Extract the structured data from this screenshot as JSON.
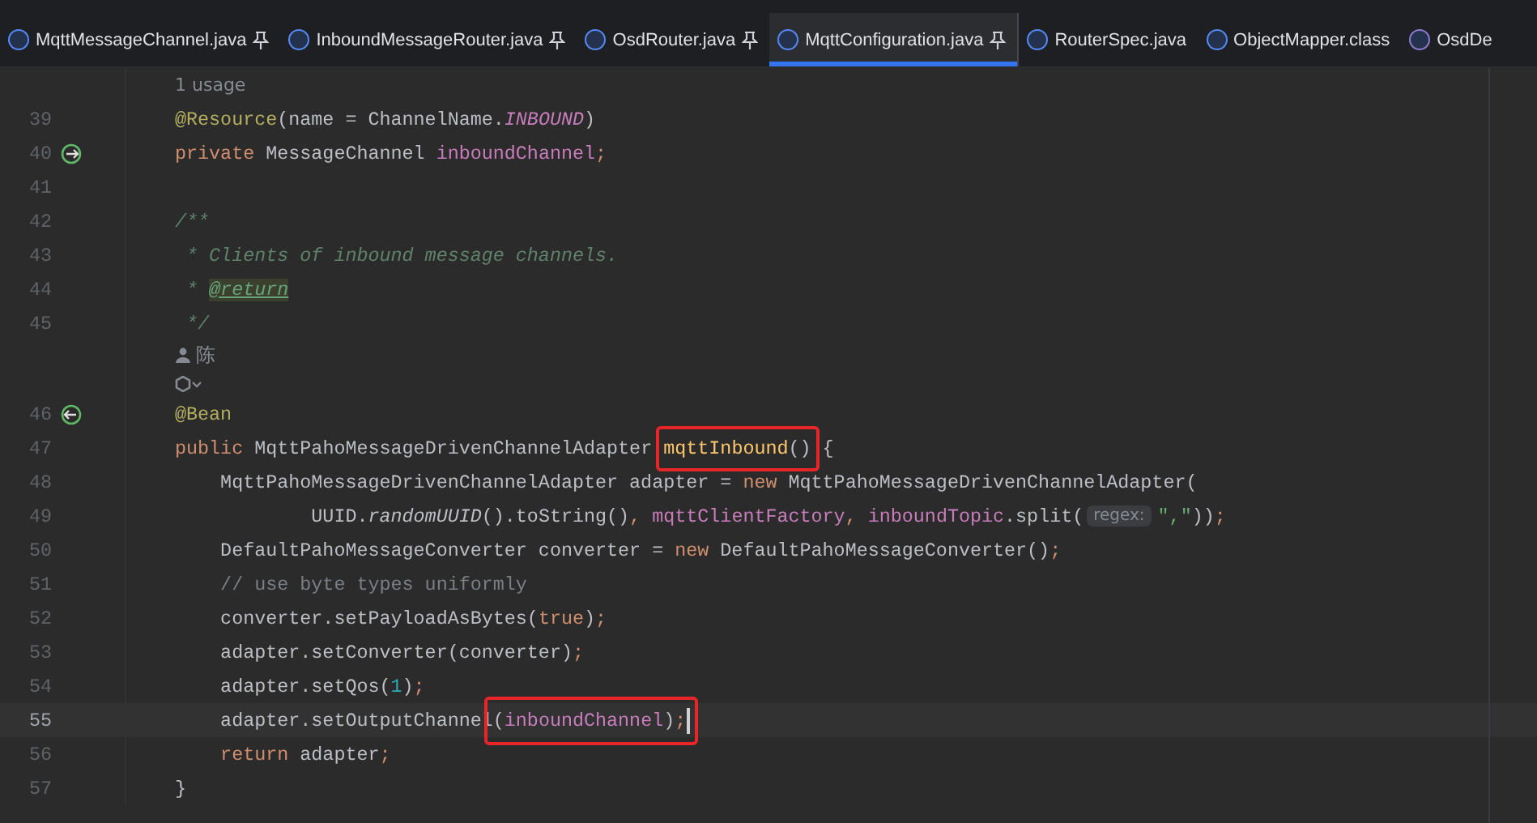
{
  "tabs": [
    {
      "label": "MqttMessageChannel.java",
      "kind": "class",
      "pinned": true,
      "selected": false
    },
    {
      "label": "InboundMessageRouter.java",
      "kind": "class",
      "pinned": true,
      "selected": false
    },
    {
      "label": "OsdRouter.java",
      "kind": "class",
      "pinned": true,
      "selected": false
    },
    {
      "label": "MqttConfiguration.java",
      "kind": "class",
      "pinned": true,
      "selected": true
    },
    {
      "label": "RouterSpec.java",
      "kind": "class",
      "pinned": false,
      "selected": false
    },
    {
      "label": "ObjectMapper.class",
      "kind": "class",
      "pinned": false,
      "selected": false
    },
    {
      "label": "OsdDe",
      "kind": "enum",
      "pinned": false,
      "selected": false
    }
  ],
  "editor": {
    "lines": [
      {
        "kind": "usage",
        "text": "1 usage"
      },
      {
        "kind": "code",
        "number": "39",
        "current": false,
        "tokens": [
          {
            "t": "@Resource",
            "kind": "ann"
          },
          {
            "t": "(name = ChannelName.",
            "kind": "plain"
          },
          {
            "t": "INBOUND",
            "kind": "static"
          },
          {
            "t": ")",
            "kind": "plain"
          }
        ]
      },
      {
        "kind": "code-bean-out",
        "number": "40",
        "current": false,
        "tokens": [
          {
            "t": "private ",
            "kind": "kw"
          },
          {
            "t": "MessageChannel ",
            "kind": "plain"
          },
          {
            "t": "inboundChannel",
            "kind": "field"
          },
          {
            "t": ";",
            "kind": "kw"
          }
        ]
      },
      {
        "kind": "code",
        "number": "41",
        "current": false
      },
      {
        "kind": "code",
        "number": "42",
        "current": false,
        "tokens": [
          {
            "t": "/**",
            "kind": "doc"
          }
        ]
      },
      {
        "kind": "code",
        "number": "43",
        "current": false,
        "tokens": [
          {
            "t": " * Clients of inbound message channels.",
            "kind": "doc"
          }
        ]
      },
      {
        "kind": "code",
        "number": "44",
        "current": false,
        "tokens": [
          {
            "t": " * ",
            "kind": "doc"
          },
          {
            "t": "@return",
            "kind": "doctag"
          }
        ]
      },
      {
        "kind": "code",
        "number": "45",
        "current": false,
        "tokens": [
          {
            "t": " */",
            "kind": "doc"
          }
        ]
      },
      {
        "kind": "author",
        "text": "陈"
      },
      {
        "kind": "ai"
      },
      {
        "kind": "code-bean-in",
        "number": "46",
        "current": false,
        "tokens": [
          {
            "t": "@Bean",
            "kind": "ann"
          }
        ]
      },
      {
        "kind": "code",
        "number": "47",
        "current": false,
        "tokens": [
          {
            "t": "public ",
            "kind": "kw"
          },
          {
            "t": "MqttPahoMessageDrivenChannelAdapter ",
            "kind": "plain"
          },
          {
            "t": "mqttInbound",
            "kind": "method",
            "boxed": true
          },
          {
            "t": "()",
            "kind": "plain",
            "boxed": true
          },
          {
            "t": " {",
            "kind": "plain"
          }
        ]
      },
      {
        "kind": "code",
        "number": "48",
        "current": false,
        "tokens": [
          {
            "t": "    MqttPahoMessageDrivenChannelAdapter adapter = ",
            "kind": "plain"
          },
          {
            "t": "new ",
            "kind": "kw"
          },
          {
            "t": "MqttPahoMessageDrivenChannelAdapter(",
            "kind": "plain"
          }
        ]
      },
      {
        "kind": "code",
        "number": "49",
        "current": false,
        "tokens": [
          {
            "t": "            UUID.",
            "kind": "plain"
          },
          {
            "t": "randomUUID",
            "kind": "italic"
          },
          {
            "t": "().toString()",
            "kind": "plain"
          },
          {
            "t": ", ",
            "kind": "kw"
          },
          {
            "t": "mqttClientFactory",
            "kind": "field"
          },
          {
            "t": ", ",
            "kind": "kw"
          },
          {
            "t": "inboundTopic",
            "kind": "field"
          },
          {
            "t": ".split(",
            "kind": "plain"
          },
          {
            "t": "regex:",
            "kind": "hint"
          },
          {
            "t": "\",\"",
            "kind": "string"
          },
          {
            "t": "))",
            "kind": "plain"
          },
          {
            "t": ";",
            "kind": "kw"
          }
        ]
      },
      {
        "kind": "code",
        "number": "50",
        "current": false,
        "tokens": [
          {
            "t": "    DefaultPahoMessageConverter converter = ",
            "kind": "plain"
          },
          {
            "t": "new ",
            "kind": "kw"
          },
          {
            "t": "DefaultPahoMessageConverter()",
            "kind": "plain"
          },
          {
            "t": ";",
            "kind": "kw"
          }
        ]
      },
      {
        "kind": "code",
        "number": "51",
        "current": false,
        "tokens": [
          {
            "t": "    // use byte types uniformly",
            "kind": "comment"
          }
        ]
      },
      {
        "kind": "code",
        "number": "52",
        "current": false,
        "tokens": [
          {
            "t": "    converter.setPayloadAsBytes(",
            "kind": "plain"
          },
          {
            "t": "true",
            "kind": "kw"
          },
          {
            "t": ")",
            "kind": "plain"
          },
          {
            "t": ";",
            "kind": "kw"
          }
        ]
      },
      {
        "kind": "code",
        "number": "53",
        "current": false,
        "tokens": [
          {
            "t": "    adapter.setConverter(converter)",
            "kind": "plain"
          },
          {
            "t": ";",
            "kind": "kw"
          }
        ]
      },
      {
        "kind": "code",
        "number": "54",
        "current": false,
        "tokens": [
          {
            "t": "    adapter.setQos(",
            "kind": "plain"
          },
          {
            "t": "1",
            "kind": "number"
          },
          {
            "t": ")",
            "kind": "plain"
          },
          {
            "t": ";",
            "kind": "kw"
          }
        ]
      },
      {
        "kind": "code",
        "number": "55",
        "current": true,
        "tokens": [
          {
            "t": "    adapter.setOutputChannel",
            "kind": "plain"
          },
          {
            "t": "(",
            "kind": "plain",
            "boxed": true
          },
          {
            "t": "inboundChannel",
            "kind": "field",
            "boxed": true
          },
          {
            "t": ")",
            "kind": "plain",
            "boxed": true
          },
          {
            "t": ";",
            "kind": "kw",
            "boxed": true
          }
        ]
      },
      {
        "kind": "code",
        "number": "56",
        "current": false,
        "tokens": [
          {
            "t": "    return ",
            "kind": "kw"
          },
          {
            "t": "adapter",
            "kind": "plain"
          },
          {
            "t": ";",
            "kind": "kw"
          }
        ]
      },
      {
        "kind": "code",
        "number": "57",
        "current": false,
        "tokens": [
          {
            "t": "}",
            "kind": "plain"
          }
        ]
      }
    ]
  }
}
